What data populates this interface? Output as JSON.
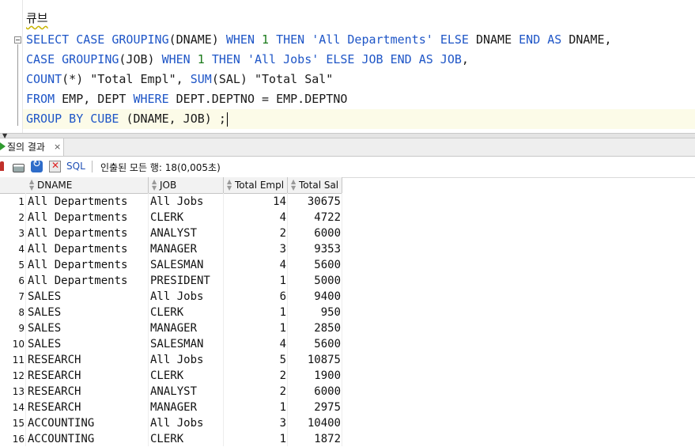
{
  "editor": {
    "comment": "큐브",
    "code_lines": [
      [
        [
          "kw",
          "SELECT CASE GROUPING"
        ],
        [
          "t",
          "(DNAME) "
        ],
        [
          "kw",
          "WHEN "
        ],
        [
          "num",
          "1 "
        ],
        [
          "kw",
          "THEN "
        ],
        [
          "str",
          "'All Departments' "
        ],
        [
          "kw",
          "ELSE "
        ],
        [
          "t",
          "DNAME "
        ],
        [
          "kw",
          "END AS "
        ],
        [
          "t",
          "DNAME,"
        ]
      ],
      [
        [
          "kw",
          "CASE GROUPING"
        ],
        [
          "t",
          "(JOB) "
        ],
        [
          "kw",
          "WHEN "
        ],
        [
          "num",
          "1 "
        ],
        [
          "kw",
          "THEN "
        ],
        [
          "str",
          "'All Jobs' "
        ],
        [
          "kw",
          "ELSE JOB END AS JOB"
        ],
        [
          "t",
          ","
        ]
      ],
      [
        [
          "kw",
          "COUNT"
        ],
        [
          "t",
          "(*) \"Total Empl\", "
        ],
        [
          "kw",
          "SUM"
        ],
        [
          "t",
          "(SAL) \"Total Sal\""
        ]
      ],
      [
        [
          "kw",
          "FROM "
        ],
        [
          "t",
          "EMP, DEPT "
        ],
        [
          "kw",
          "WHERE "
        ],
        [
          "t",
          "DEPT.DEPTNO = EMP.DEPTNO"
        ]
      ],
      [
        [
          "kw",
          "GROUP BY CUBE "
        ],
        [
          "t",
          "(DNAME, JOB) ;"
        ]
      ]
    ]
  },
  "results_tab": {
    "label": "질의 결과",
    "close": "×"
  },
  "toolbar": {
    "sql_label": "SQL",
    "status": "인출된 모든 행: 18(0,005초)"
  },
  "grid": {
    "columns": [
      "DNAME",
      "JOB",
      "Total Empl",
      "Total Sal"
    ],
    "rows": [
      [
        "1",
        "All Departments",
        "All Jobs",
        "14",
        "30675"
      ],
      [
        "2",
        "All Departments",
        "CLERK",
        "4",
        "4722"
      ],
      [
        "3",
        "All Departments",
        "ANALYST",
        "2",
        "6000"
      ],
      [
        "4",
        "All Departments",
        "MANAGER",
        "3",
        "9353"
      ],
      [
        "5",
        "All Departments",
        "SALESMAN",
        "4",
        "5600"
      ],
      [
        "6",
        "All Departments",
        "PRESIDENT",
        "1",
        "5000"
      ],
      [
        "7",
        "SALES",
        "All Jobs",
        "6",
        "9400"
      ],
      [
        "8",
        "SALES",
        "CLERK",
        "1",
        "950"
      ],
      [
        "9",
        "SALES",
        "MANAGER",
        "1",
        "2850"
      ],
      [
        "10",
        "SALES",
        "SALESMAN",
        "4",
        "5600"
      ],
      [
        "11",
        "RESEARCH",
        "All Jobs",
        "5",
        "10875"
      ],
      [
        "12",
        "RESEARCH",
        "CLERK",
        "2",
        "1900"
      ],
      [
        "13",
        "RESEARCH",
        "ANALYST",
        "2",
        "6000"
      ],
      [
        "14",
        "RESEARCH",
        "MANAGER",
        "1",
        "2975"
      ],
      [
        "15",
        "ACCOUNTING",
        "All Jobs",
        "3",
        "10400"
      ],
      [
        "16",
        "ACCOUNTING",
        "CLERK",
        "1",
        "1872"
      ]
    ]
  },
  "colors": {
    "keyword": "#1f56c7",
    "number": "#1a7a1a",
    "current_line": "#fcfbe8"
  }
}
